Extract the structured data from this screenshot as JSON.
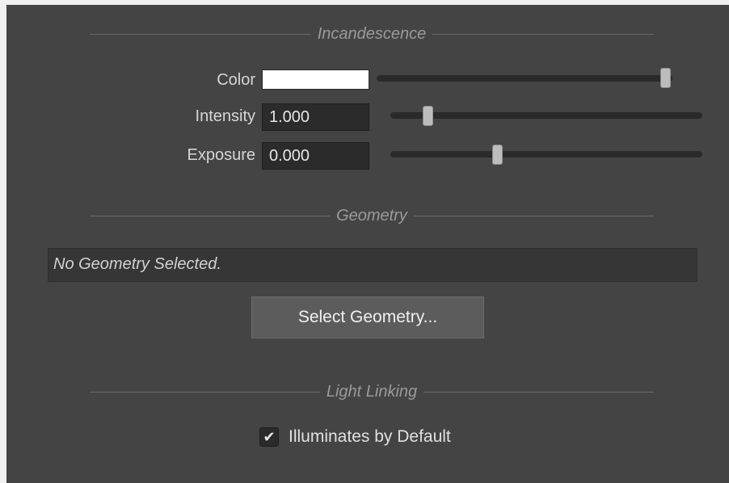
{
  "incandescence": {
    "title": "Incandescence",
    "color_label": "Color",
    "color_value": "#ffffff",
    "intensity_label": "Intensity",
    "intensity_value": "1.000",
    "intensity_slider_fraction": 0.12,
    "exposure_label": "Exposure",
    "exposure_value": "0.000",
    "exposure_slider_fraction": 0.34,
    "color_slider_fraction": 0.97
  },
  "geometry": {
    "title": "Geometry",
    "status_text": "No Geometry Selected.",
    "select_button_label": "Select Geometry..."
  },
  "light_linking": {
    "title": "Light Linking",
    "illuminates_label": "Illuminates by Default",
    "illuminates_checked": true,
    "check_glyph": "✔"
  }
}
